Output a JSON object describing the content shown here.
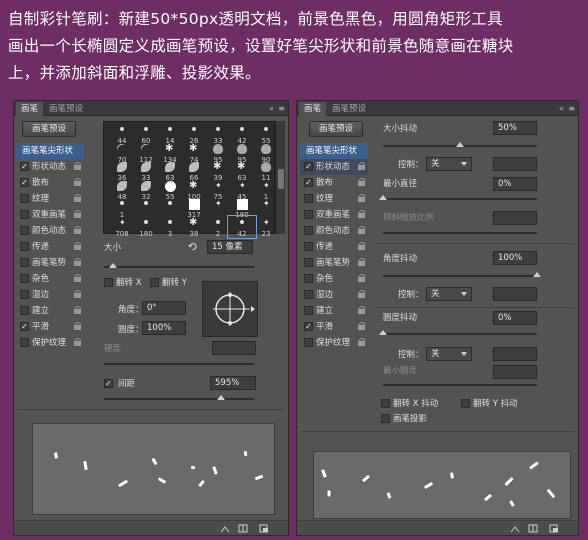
{
  "instruction": {
    "line1": "自制彩针笔刷：新建50*50px透明文档，前景色黑色，用圆角矩形工具",
    "line2": "画出一个长椭圆定义成画笔预设，设置好笔尖形状和前景色随意画在糖块",
    "line3": "上，并添加斜面和浮雕、投影效果。"
  },
  "left_panel": {
    "tabs": [
      "画笔",
      "画笔预设"
    ],
    "tab_controls": [
      "«",
      "≡"
    ],
    "preset_button": "画笔预设",
    "options": [
      {
        "label": "画笔笔尖形状",
        "checked": null,
        "lock": false,
        "header": true
      },
      {
        "label": "形状动态",
        "checked": true,
        "lock": true
      },
      {
        "label": "散布",
        "checked": true,
        "lock": true
      },
      {
        "label": "纹理",
        "checked": false,
        "lock": true
      },
      {
        "label": "双重画笔",
        "checked": false,
        "lock": true
      },
      {
        "label": "颜色动态",
        "checked": false,
        "lock": true
      },
      {
        "label": "传递",
        "checked": false,
        "lock": true
      },
      {
        "label": "画笔笔势",
        "checked": false,
        "lock": true
      },
      {
        "label": "杂色",
        "checked": false,
        "lock": true
      },
      {
        "label": "湿边",
        "checked": false,
        "lock": true
      },
      {
        "label": "建立",
        "checked": false,
        "lock": true
      },
      {
        "label": "平滑",
        "checked": true,
        "lock": true
      },
      {
        "label": "保护纹理",
        "checked": false,
        "lock": true
      }
    ],
    "tip_sizes": [
      [
        "44",
        "60",
        "14",
        "26",
        "33",
        "42",
        "55"
      ],
      [
        "70",
        "112",
        "134",
        "74",
        "95",
        "95",
        "90"
      ],
      [
        "36",
        "33",
        "63",
        "66",
        "39",
        "63",
        "11"
      ],
      [
        "48",
        "32",
        "55",
        "100",
        "75",
        "45",
        "1"
      ],
      [
        "1",
        "",
        "",
        "317",
        "",
        "180",
        ""
      ],
      [
        "708",
        "180",
        "3",
        "38",
        "2",
        "42",
        "23"
      ]
    ],
    "size_label": "大小",
    "size_value": "15 像素",
    "flip_x": "翻转 X",
    "flip_y": "翻转 Y",
    "angle_label": "角度：",
    "angle_value": "0°",
    "roundness_label": "圆度：",
    "roundness_value": "100%",
    "hardness_label": "硬度",
    "spacing_checked": true,
    "spacing_label": "间距",
    "spacing_value": "595%",
    "spacing_fraction": 0.78,
    "size_fraction": 0.06
  },
  "right_panel": {
    "tabs": [
      "画笔",
      "画笔预设"
    ],
    "tab_controls": [
      "«",
      "≡"
    ],
    "preset_button": "画笔预设",
    "options": [
      {
        "label": "画笔笔尖形状",
        "checked": null,
        "lock": false,
        "header": true
      },
      {
        "label": "形状动态",
        "checked": true,
        "lock": true,
        "selected": true
      },
      {
        "label": "散布",
        "checked": true,
        "lock": true
      },
      {
        "label": "纹理",
        "checked": false,
        "lock": true
      },
      {
        "label": "双重画笔",
        "checked": false,
        "lock": true
      },
      {
        "label": "颜色动态",
        "checked": false,
        "lock": true
      },
      {
        "label": "传递",
        "checked": false,
        "lock": true
      },
      {
        "label": "画笔笔势",
        "checked": false,
        "lock": true
      },
      {
        "label": "杂色",
        "checked": false,
        "lock": true
      },
      {
        "label": "湿边",
        "checked": false,
        "lock": true
      },
      {
        "label": "建立",
        "checked": false,
        "lock": true
      },
      {
        "label": "平滑",
        "checked": true,
        "lock": true
      },
      {
        "label": "保护纹理",
        "checked": false,
        "lock": true
      }
    ],
    "size_jitter_label": "大小抖动",
    "size_jitter_value": "50%",
    "control_label": "控制：",
    "control_value": "关",
    "min_diameter_label": "最小直径",
    "min_diameter_value": "0%",
    "tilt_scale_label": "倾斜缩放比例",
    "angle_jitter_label": "角度抖动",
    "angle_jitter_value": "100%",
    "angle_control_value": "关",
    "roundness_jitter_label": "圆度抖动",
    "roundness_jitter_value": "0%",
    "roundness_control_value": "关",
    "min_roundness_label": "最小圆度",
    "flip_x_jitter": "翻转 X 抖动",
    "flip_y_jitter": "翻转 Y 抖动",
    "brush_projection": "画笔投影",
    "size_jitter_fraction": 0.5,
    "angle_jitter_fraction": 1.0,
    "roundness_jitter_fraction": 0.0
  },
  "colors": {
    "background": "#6e2e63",
    "panel": "#535353",
    "selected_row": "#3b5f8c"
  }
}
